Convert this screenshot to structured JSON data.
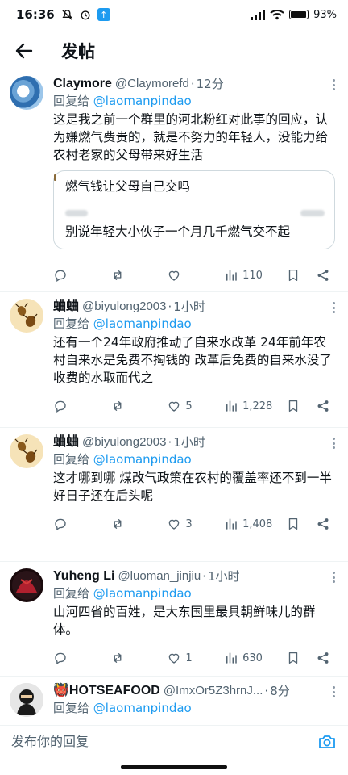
{
  "status_bar": {
    "time": "16:36",
    "battery": "93%",
    "battery_level": 0.93,
    "app_badge": "↑"
  },
  "header": {
    "title": "发帖"
  },
  "tweets": [
    {
      "author": "Claymore",
      "handle": "@Claymorefd",
      "time": "12分",
      "reply_prefix": "回复给",
      "reply_mention": "@laomanpindao",
      "text": "这是我之前一个群里的河北粉红对此事的回应，认为嫌燃气费贵的，就是不努力的年轻人，没能力给农村老家的父母带来好生活",
      "quote": {
        "line1": "燃气钱让父母自己交吗",
        "line2": "别说年轻大小伙子一个月几千燃气交不起"
      },
      "stats": {
        "replies": "",
        "retweets": "",
        "likes": "",
        "views": "110"
      }
    },
    {
      "author": "蛐蛐",
      "handle": "@biyulong2003",
      "time": "1小时",
      "reply_prefix": "回复给",
      "reply_mention": "@laomanpindao",
      "text": "还有一个24年政府推动了自来水改革  24年前年农村自来水是免费不掏钱的   改革后免费的自来水没了  收费的水取而代之",
      "stats": {
        "replies": "",
        "retweets": "",
        "likes": "5",
        "views": "1,228"
      }
    },
    {
      "author": "蛐蛐",
      "handle": "@biyulong2003",
      "time": "1小时",
      "reply_prefix": "回复给",
      "reply_mention": "@laomanpindao",
      "text_lines": [
        "这才哪到哪  煤改气政策在农村的覆盖率还不到一半",
        "好日子还在后头呢"
      ],
      "stats": {
        "replies": "",
        "retweets": "",
        "likes": "3",
        "views": "1,408"
      }
    },
    {
      "author": "Yuheng Li",
      "handle": "@luoman_jinjiu",
      "time": "1小时",
      "reply_prefix": "回复给",
      "reply_mention": "@laomanpindao",
      "text": "山河四省的百姓，是大东国里最具朝鲜味儿的群体。",
      "stats": {
        "replies": "",
        "retweets": "",
        "likes": "1",
        "views": "630"
      }
    },
    {
      "author": "👹HOTSEAFOOD",
      "handle": "@ImxOr5Z3hrnJ...",
      "time": "8分",
      "reply_prefix": "回复给",
      "reply_mention": "@laomanpindao"
    }
  ],
  "composer": {
    "placeholder": "发布你的回复"
  },
  "colors": {
    "accent": "#1d9bf0",
    "text": "#0f1419",
    "muted": "#536471",
    "border": "#eff3f4"
  }
}
